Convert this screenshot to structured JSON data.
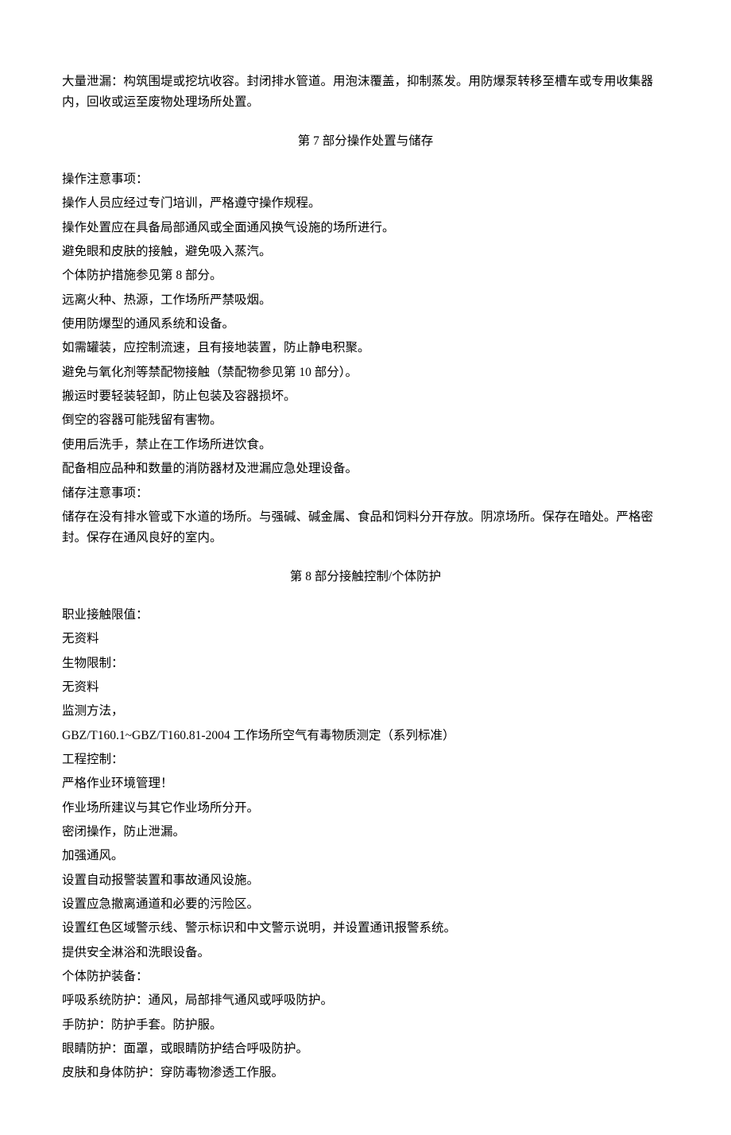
{
  "intro": "大量泄漏：构筑围堤或挖坑收容。封闭排水管道。用泡沫覆盖，抑制蒸发。用防爆泵转移至槽车或专用收集器内，回收或运至废物处理场所处置。",
  "section7": {
    "title": "第 7 部分操作处置与储存",
    "lines": [
      "操作注意事项：",
      "操作人员应经过专门培训，严格遵守操作规程。",
      "操作处置应在具备局部通风或全面通风换气设施的场所进行。",
      "避免眼和皮肤的接触，避免吸入蒸汽。",
      "个体防护措施参见第 8 部分。",
      "远离火种、热源，工作场所严禁吸烟。",
      "使用防爆型的通风系统和设备。",
      "如需罐装，应控制流速，且有接地装置，防止静电积聚。",
      "避免与氧化剂等禁配物接触（禁配物参见第 10 部分）。",
      "搬运时要轻装轻卸，防止包装及容器损坏。",
      "倒空的容器可能残留有害物。",
      "使用后洗手，禁止在工作场所进饮食。",
      "配备相应品种和数量的消防器材及泄漏应急处理设备。",
      "储存注意事项：",
      "储存在没有排水管或下水道的场所。与强碱、碱金属、食品和饲料分开存放。阴凉场所。保存在暗处。严格密封。保存在通风良好的室内。"
    ]
  },
  "section8": {
    "title": "第 8 部分接触控制/个体防护",
    "lines": [
      "职业接触限值：",
      "无资料",
      "生物限制：",
      "无资料",
      "监测方法，",
      "GBZ/T160.1~GBZ/T160.81-2004 工作场所空气有毒物质测定（系列标准）",
      "工程控制：",
      "严格作业环境管理！",
      "作业场所建议与其它作业场所分开。",
      "密闭操作，防止泄漏。",
      "加强通风。",
      "设置自动报警装置和事故通风设施。",
      "设置应急撤离通道和必要的污险区。",
      "设置红色区域警示线、警示标识和中文警示说明，并设置通讯报警系统。",
      "提供安全淋浴和洗眼设备。",
      "个体防护装备：",
      "呼吸系统防护：通风，局部排气通风或呼吸防护。",
      "手防护：防护手套。防护服。",
      "眼睛防护：面罩，或眼睛防护结合呼吸防护。",
      "皮肤和身体防护：穿防毒物渗透工作服。"
    ]
  }
}
